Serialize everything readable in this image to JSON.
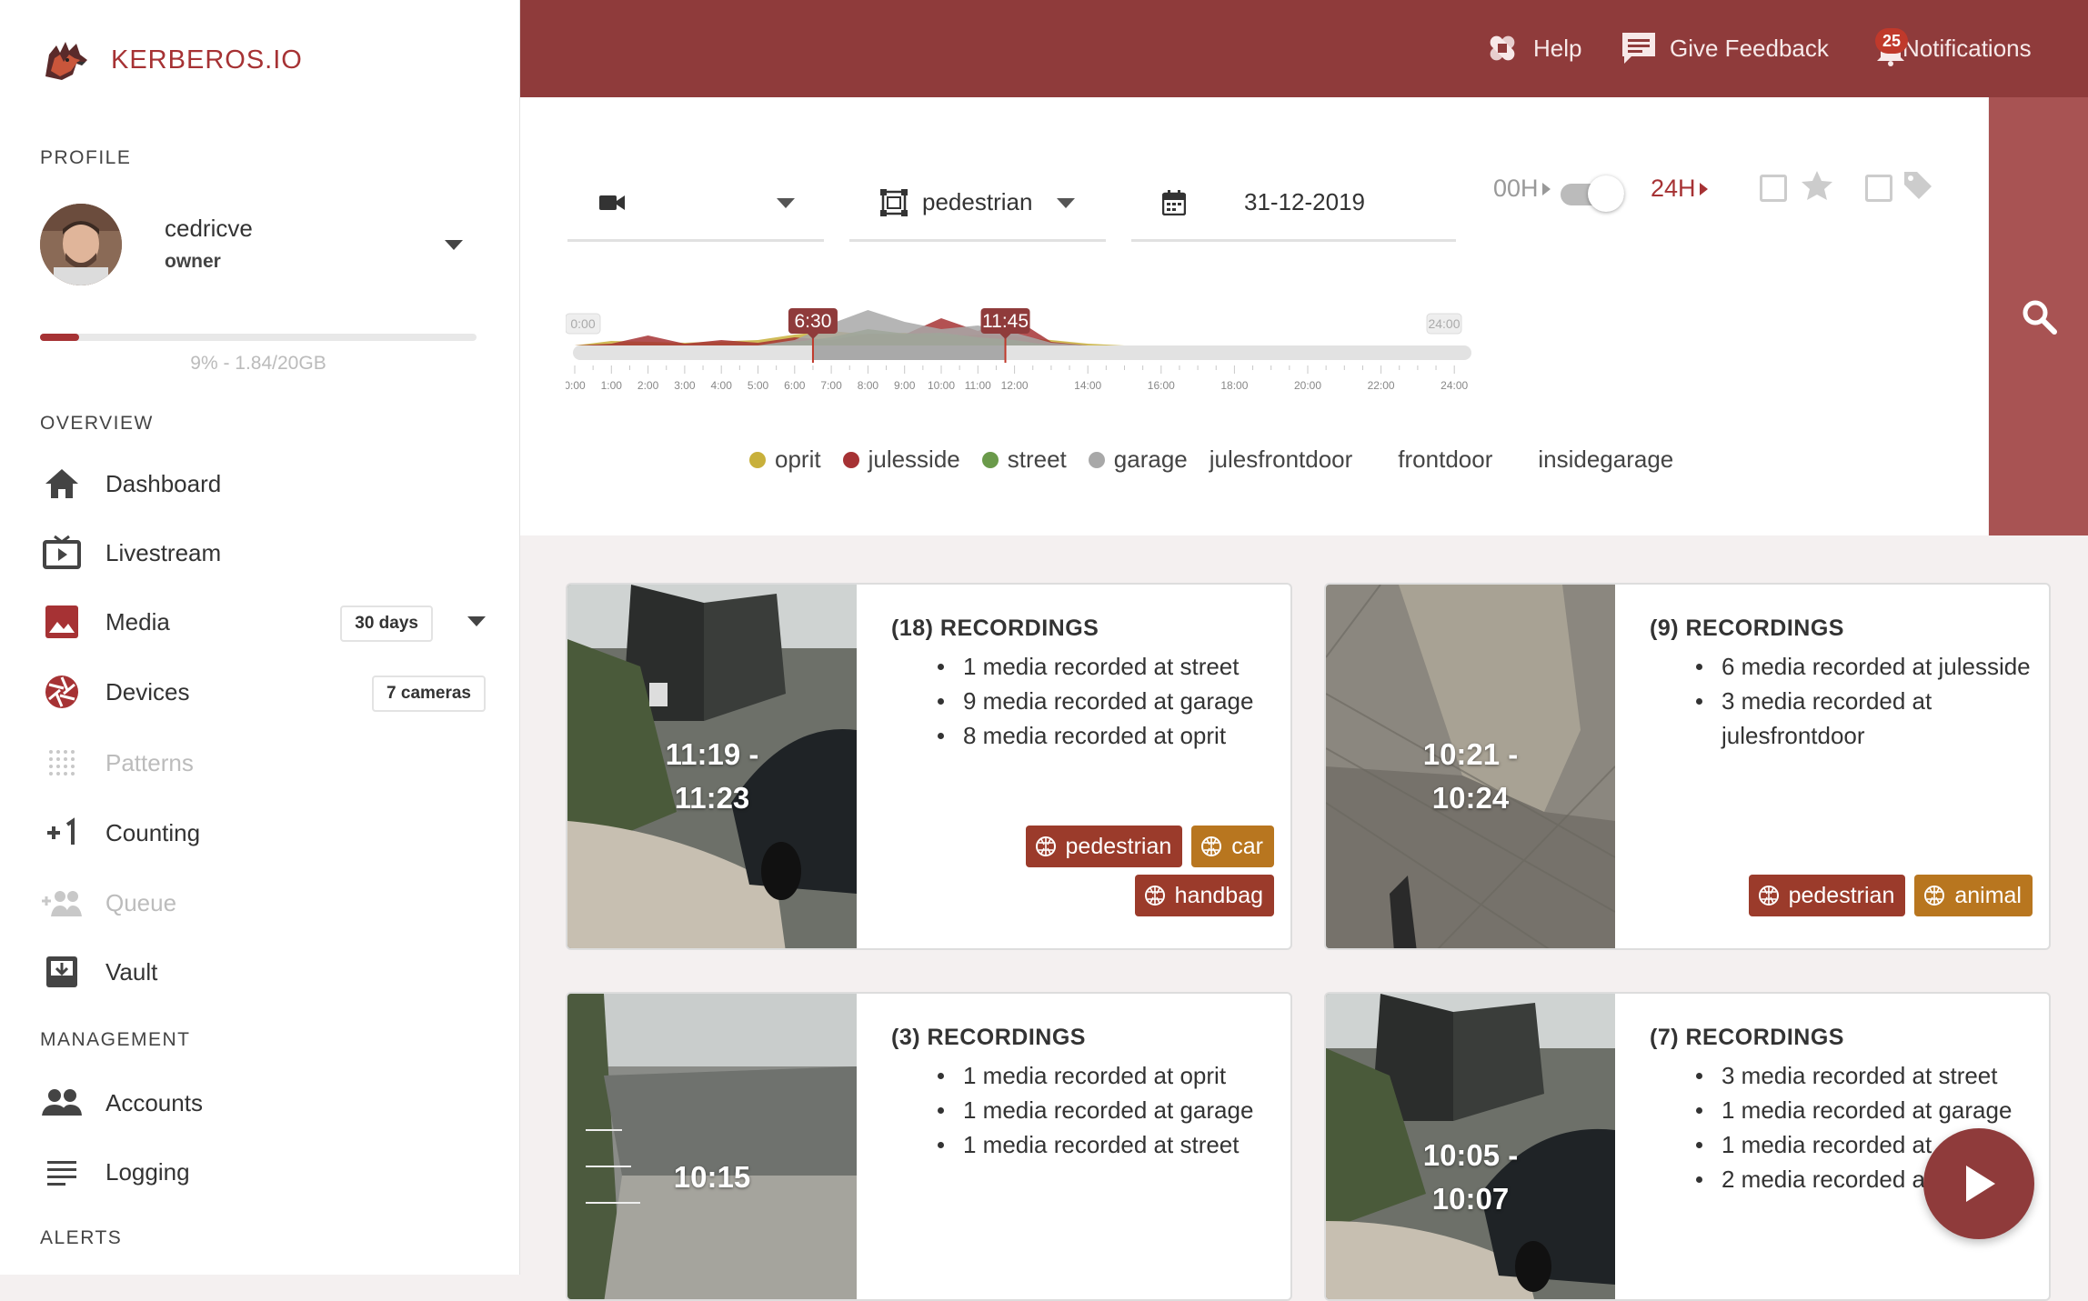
{
  "app": {
    "name": "KERBEROS.IO"
  },
  "colors": {
    "accent": "#a63234",
    "topbar": "#8f3b3b",
    "search": "#a85353",
    "tag_red": "#9b3b2b",
    "tag_orange": "#b8761f"
  },
  "profile": {
    "section": "PROFILE",
    "name": "cedricve",
    "role": "owner",
    "storage_text": "9% - 1.84/20GB",
    "storage_fraction": 0.09
  },
  "overview": {
    "section": "OVERVIEW",
    "items": [
      {
        "label": "Dashboard",
        "icon": "home-icon"
      },
      {
        "label": "Livestream",
        "icon": "tv-play-icon"
      },
      {
        "label": "Media",
        "icon": "image-icon",
        "badge": "30 days"
      },
      {
        "label": "Devices",
        "icon": "camera-shutter-icon",
        "badge": "7 cameras"
      },
      {
        "label": "Patterns",
        "icon": "dots-grid-icon"
      },
      {
        "label": "Counting",
        "icon": "plus-one-icon"
      },
      {
        "label": "Queue",
        "icon": "add-group-icon"
      },
      {
        "label": "Vault",
        "icon": "archive-icon"
      }
    ]
  },
  "management": {
    "section": "MANAGEMENT",
    "items": [
      {
        "label": "Accounts",
        "icon": "people-icon"
      },
      {
        "label": "Logging",
        "icon": "list-lines-icon"
      }
    ]
  },
  "alerts": {
    "section": "ALERTS"
  },
  "topbar": {
    "help": "Help",
    "feedback": "Give Feedback",
    "notifications": "Notifications",
    "notification_count": "25"
  },
  "filters": {
    "camera_value": "",
    "classification": "pedestrian",
    "date": "31-12-2019",
    "hour_start": "00H",
    "hour_end": "24H"
  },
  "timeline": {
    "start_label": "0:00",
    "end_label": "24:00",
    "selection_start": "6:30",
    "selection_end": "11:45",
    "ticks": [
      "0:00",
      "1:00",
      "2:00",
      "3:00",
      "4:00",
      "5:00",
      "6:00",
      "7:00",
      "8:00",
      "9:00",
      "10:00",
      "11:00",
      "12:00",
      "14:00",
      "16:00",
      "18:00",
      "20:00",
      "22:00",
      "24:00"
    ],
    "tick_hours": [
      0,
      1,
      2,
      3,
      4,
      5,
      6,
      7,
      8,
      9,
      10,
      11,
      12,
      14,
      16,
      18,
      20,
      22,
      24
    ],
    "series": [
      {
        "name": "oprit",
        "color": "#c8b03b",
        "points": [
          [
            0,
            0
          ],
          [
            1,
            0.5
          ],
          [
            3,
            0.3
          ],
          [
            5,
            0.6
          ],
          [
            6,
            1.2
          ],
          [
            7,
            1.6
          ],
          [
            8,
            1.2
          ],
          [
            9,
            1.4
          ],
          [
            10,
            1.0
          ],
          [
            11,
            1.2
          ],
          [
            12,
            1.0
          ],
          [
            13,
            0.6
          ],
          [
            14,
            0.2
          ],
          [
            15,
            0
          ]
        ]
      },
      {
        "name": "julesside",
        "color": "#a63234",
        "points": [
          [
            0,
            0
          ],
          [
            1,
            0.2
          ],
          [
            2,
            1.1
          ],
          [
            3,
            0.2
          ],
          [
            4,
            0.6
          ],
          [
            5,
            0.3
          ],
          [
            6,
            0.9
          ],
          [
            7,
            0.6
          ],
          [
            8,
            1.3
          ],
          [
            9,
            1.2
          ],
          [
            10,
            3.0
          ],
          [
            11,
            1.6
          ],
          [
            12,
            3.0
          ],
          [
            13,
            0.4
          ],
          [
            14,
            0
          ]
        ]
      },
      {
        "name": "street",
        "color": "#6a9a4a",
        "points": [
          [
            5,
            0
          ],
          [
            6,
            0.4
          ],
          [
            7,
            0.9
          ],
          [
            8,
            1.8
          ],
          [
            9,
            1.3
          ],
          [
            10,
            1.4
          ],
          [
            11,
            0.9
          ],
          [
            12,
            0.6
          ],
          [
            13,
            0
          ]
        ]
      },
      {
        "name": "garage",
        "color": "#a8a8a8",
        "points": [
          [
            5,
            0
          ],
          [
            6,
            0.6
          ],
          [
            7,
            2.4
          ],
          [
            8,
            3.9
          ],
          [
            9,
            2.6
          ],
          [
            10,
            1.8
          ],
          [
            11,
            2.2
          ],
          [
            12,
            1.4
          ],
          [
            13,
            0.3
          ],
          [
            14,
            0
          ]
        ]
      }
    ],
    "legend": [
      {
        "name": "oprit",
        "color": "#c8b03b",
        "marker": true
      },
      {
        "name": "julesside",
        "color": "#a63234",
        "marker": true
      },
      {
        "name": "street",
        "color": "#6a9a4a",
        "marker": true
      },
      {
        "name": "garage",
        "color": "#a8a8a8",
        "marker": true
      },
      {
        "name": "julesfrontdoor",
        "marker": false
      },
      {
        "name": "frontdoor",
        "marker": false
      },
      {
        "name": "insidegarage",
        "marker": false
      }
    ]
  },
  "cards": [
    {
      "time_lines": [
        "11:19 -",
        "11:23"
      ],
      "title": "(18) RECORDINGS",
      "items": [
        "1 media recorded at street",
        "9 media recorded at garage",
        "8 media recorded at oprit"
      ],
      "tags": [
        {
          "label": "pedestrian",
          "tone": "red"
        },
        {
          "label": "car",
          "tone": "orange"
        },
        {
          "label": "handbag",
          "tone": "red"
        }
      ]
    },
    {
      "time_lines": [
        "10:21 -",
        "10:24"
      ],
      "title": "(9) RECORDINGS",
      "items": [
        "6 media recorded at julesside",
        "3 media recorded at julesfrontdoor"
      ],
      "tags": [
        {
          "label": "pedestrian",
          "tone": "red"
        },
        {
          "label": "animal",
          "tone": "orange"
        }
      ]
    },
    {
      "time_lines": [
        "10:15"
      ],
      "title": "(3) RECORDINGS",
      "items": [
        "1 media recorded at oprit",
        "1 media recorded at garage",
        "1 media recorded at street"
      ],
      "tags": []
    },
    {
      "time_lines": [
        "10:05 -",
        "10:07"
      ],
      "title": "(7) RECORDINGS",
      "items": [
        "3 media recorded at street",
        "1 media recorded at garage",
        "1 media recorded at",
        "2 media recorded at"
      ],
      "tags": []
    }
  ]
}
